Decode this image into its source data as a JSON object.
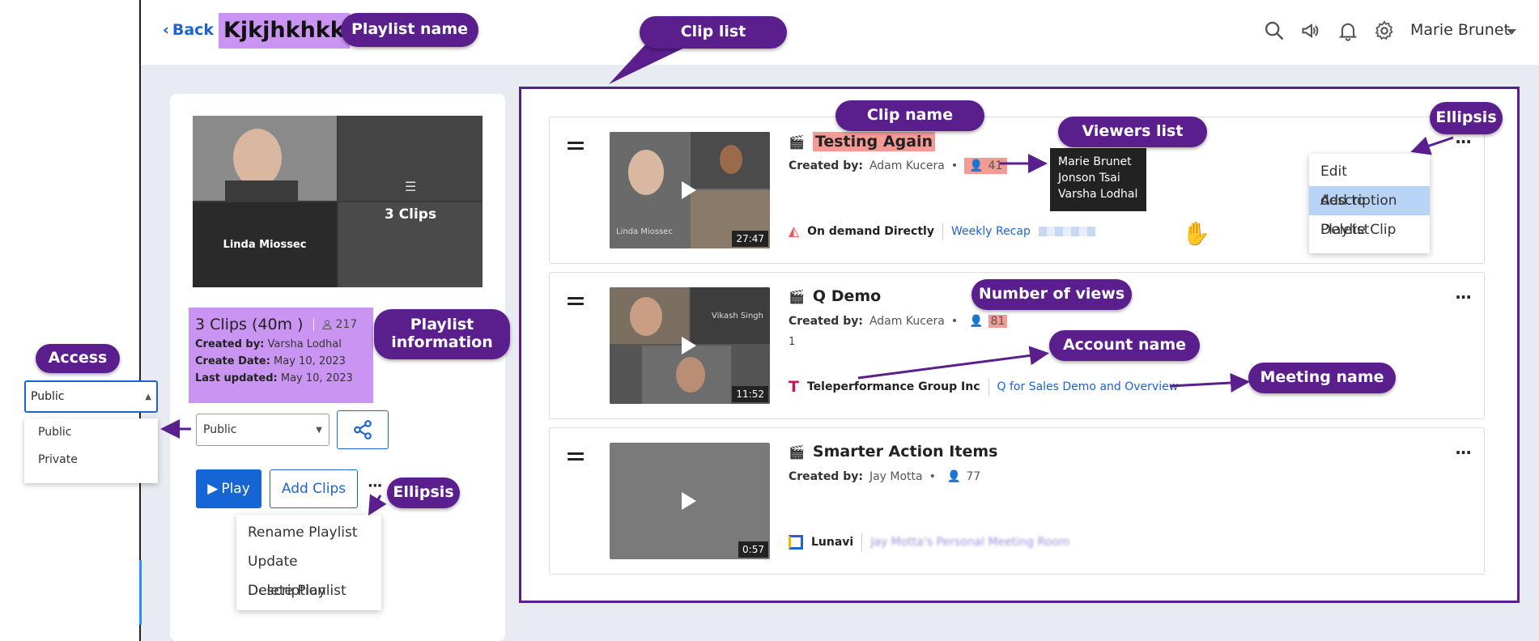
{
  "header": {
    "back_label": "Back",
    "playlist_title": "Kjkjhkhkk",
    "user_name": "Marie Brunet",
    "icons": [
      "search-icon",
      "megaphone-icon",
      "bell-icon",
      "gear-icon"
    ]
  },
  "callouts": {
    "playlist_name": "Playlist name",
    "clip_list": "Clip list",
    "clip_name": "Clip name",
    "viewers_list": "Viewers list",
    "ellipsis_top": "Ellipsis",
    "number_of_views": "Number of views",
    "account_name": "Account name",
    "meeting_name": "Meeting name",
    "playlist_information": "Playlist information",
    "access": "Access",
    "ellipsis_left": "Ellipsis"
  },
  "playlist": {
    "thumbnail_labels": {
      "speaker": "Linda Miossec",
      "clips_overlay": "3 Clips"
    },
    "summary": "3 Clips (40m )",
    "viewer_count": "217",
    "created_by_label": "Created by:",
    "created_by": "Varsha Lodhal",
    "create_date_label": "Create Date:",
    "create_date": "May 10, 2023",
    "last_updated_label": "Last updated:",
    "last_updated": "May 10, 2023",
    "access_value": "Public",
    "play_label": "Play",
    "add_clips_label": "Add Clips",
    "menu": [
      "Rename Playlist",
      "Update Description",
      "Delete Playlist"
    ]
  },
  "access_dropdown": {
    "value": "Public",
    "options": [
      "Public",
      "Private"
    ]
  },
  "clips": [
    {
      "name": "Testing Again",
      "created_by_label": "Created by:",
      "created_by": "Adam Kucera",
      "views": "41",
      "duration": "27:47",
      "thumb_label": "Linda Miossec",
      "account": "On demand Directly",
      "meeting": "Weekly Recap",
      "extra": ""
    },
    {
      "name": "Q Demo",
      "created_by_label": "Created by:",
      "created_by": "Adam Kucera",
      "views": "81",
      "duration": "11:52",
      "thumb_label": "Vikash Singh",
      "account": "Teleperformance Group Inc",
      "meeting": "Q for Sales Demo and Overview",
      "extra": "1"
    },
    {
      "name": "Smarter Action Items",
      "created_by_label": "Created by:",
      "created_by": "Jay Motta",
      "views": "77",
      "duration": "0:57",
      "thumb_label": "",
      "account": "Lunavi",
      "meeting": "Jay Motta's Personal Meeting Room",
      "extra": ""
    }
  ],
  "viewers_tooltip": [
    "Marie Brunet",
    "Jonson Tsai",
    "Varsha Lodhal"
  ],
  "clip_menu": {
    "items": [
      "Edit description",
      "Add to Playlist",
      "Delete Clip"
    ],
    "selected": "Add to Playlist"
  },
  "colors": {
    "accent": "#1c63d6",
    "callout": "#5a1f8c",
    "highlight_purple": "#c994f2",
    "highlight_red": "#f59a95"
  }
}
